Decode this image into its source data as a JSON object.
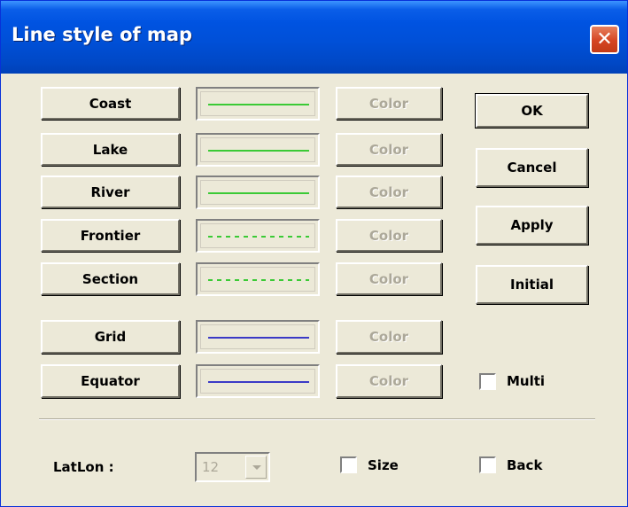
{
  "window": {
    "title": "Line style of map",
    "close_glyph": "✕"
  },
  "line_rows": [
    {
      "label": "Coast",
      "style": "solid",
      "line_color": "#00c000",
      "color_label": "Color"
    },
    {
      "label": "Lake",
      "style": "solid",
      "line_color": "#00c000",
      "color_label": "Color"
    },
    {
      "label": "River",
      "style": "solid",
      "line_color": "#00c000",
      "color_label": "Color"
    },
    {
      "label": "Frontier",
      "style": "dashed",
      "line_color": "#00c000",
      "color_label": "Color"
    },
    {
      "label": "Section",
      "style": "dashed",
      "line_color": "#00c000",
      "color_label": "Color"
    },
    {
      "label": "Grid",
      "style": "solid",
      "line_color": "#0000c0",
      "color_label": "Color"
    },
    {
      "label": "Equator",
      "style": "solid",
      "line_color": "#0000c0",
      "color_label": "Color"
    }
  ],
  "actions": {
    "ok": "OK",
    "cancel": "Cancel",
    "apply": "Apply",
    "initial": "Initial"
  },
  "multi": {
    "label": "Multi",
    "checked": false
  },
  "latlon": {
    "label": "LatLon :",
    "value": "12",
    "disabled": true
  },
  "size": {
    "label": "Size",
    "checked": false
  },
  "back": {
    "label": "Back",
    "checked": false
  }
}
